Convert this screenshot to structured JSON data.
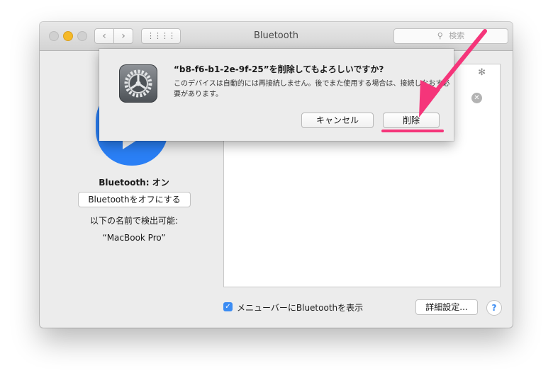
{
  "window": {
    "title": "Bluetooth",
    "back_glyph": "‹",
    "forward_glyph": "›",
    "grid_glyph": "⋮⋮⋮⋮",
    "search_placeholder": "検索"
  },
  "bluetooth": {
    "status": "Bluetooth: オン",
    "toggle_button": "Bluetoothをオフにする",
    "discoverable_label": "以下の名前で検出可能:",
    "device_name": "“MacBook Pro”"
  },
  "footer": {
    "show_in_menubar_label": "メニューバーにBluetoothを表示",
    "show_in_menubar_checked": true,
    "advanced_button": "詳細設定...",
    "help_button": "?"
  },
  "dialog": {
    "title": "“b8-f6-b1-2e-9f-25”を削除してもよろしいですか?",
    "body": "このデバイスは自動的には再接続しません。後でまた使用する場合は、接続しなおす必要があります。",
    "cancel_button": "キャンセル",
    "delete_button": "削除"
  },
  "colors": {
    "accent": "#3b8cf3",
    "bluetooth_blue": "#2a7ff5",
    "annotation_pink": "#f5357a"
  },
  "icons": {
    "device_remove": "remove-icon",
    "spinner": "spinner-icon",
    "prefs": "system-preferences-gear-icon"
  }
}
